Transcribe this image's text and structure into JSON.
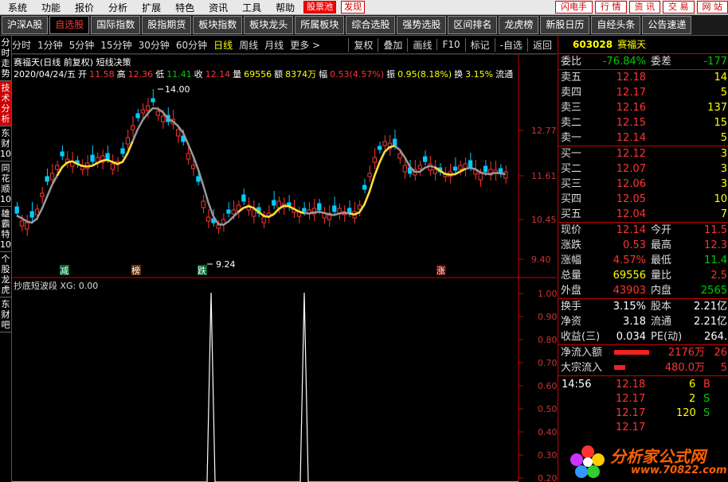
{
  "menu": {
    "items": [
      "系统",
      "功能",
      "报价",
      "分析",
      "扩展",
      "特色",
      "资讯",
      "工具",
      "帮助"
    ],
    "tag1": "股票池",
    "tag2": "发现",
    "right": [
      "闪电手",
      "行 情",
      "资 讯",
      "交 易",
      "网 站"
    ]
  },
  "tabs": [
    "沪深A股",
    "自选股",
    "国际指数",
    "股指期货",
    "板块指数",
    "板块龙头",
    "所属板块",
    "综合选股",
    "强势选股",
    "区间排名",
    "龙虎榜",
    "新股日历",
    "自经头条",
    "公告速递"
  ],
  "periods": [
    "分时",
    "1分钟",
    "5分钟",
    "15分钟",
    "30分钟",
    "60分钟",
    "日线",
    "周线",
    "月线",
    "更多 >"
  ],
  "toolbtns": [
    "复权",
    "叠加",
    "画线",
    "F10",
    "标记",
    "-自选",
    "返回"
  ],
  "lside": [
    "分时走势",
    "技术分析",
    "东财10",
    "同花顺10",
    "雄霸特10",
    "个股龙虎",
    "东财吧"
  ],
  "chart": {
    "title": "赛福天(日线 前复权) 短线决策",
    "date": "2020/04/24/五",
    "open_l": "开",
    "open": "11.58",
    "high_l": "高",
    "high": "12.36",
    "low_l": "低",
    "low": "11.41",
    "close_l": "收",
    "close": "12.14",
    "vol_l": "量",
    "vol": "69556",
    "amt_l": "额",
    "amt": "8374万",
    "chg_l": "幅",
    "chg": "0.53(4.57%)",
    "amp_l": "振",
    "amp": "0.95(8.18%)",
    "turn_l": "换",
    "turn": "3.15%",
    "flow": "流通",
    "max_label": "14.00",
    "min_label": "9.24",
    "axis": [
      "12.77",
      "11.61",
      "10.45",
      "9.40"
    ],
    "markers": [
      "减",
      "榜",
      "跌",
      "涨"
    ],
    "sub_title": "抄底短波段 XG: 0.00",
    "sub_axis": [
      "1.00",
      "0.90",
      "0.80",
      "0.70",
      "0.60",
      "0.50",
      "0.40",
      "0.30",
      "0.20"
    ]
  },
  "quote": {
    "code": "603028",
    "name": "赛福天",
    "wb_l": "委比",
    "wb": "-76.84%",
    "wc_l": "委差",
    "wc": "-177",
    "asks": [
      {
        "l": "卖五",
        "p": "12.18",
        "v": "14"
      },
      {
        "l": "卖四",
        "p": "12.17",
        "v": "5"
      },
      {
        "l": "卖三",
        "p": "12.16",
        "v": "137"
      },
      {
        "l": "卖二",
        "p": "12.15",
        "v": "15"
      },
      {
        "l": "卖一",
        "p": "12.14",
        "v": "5"
      }
    ],
    "bids": [
      {
        "l": "买一",
        "p": "12.12",
        "v": "3"
      },
      {
        "l": "买二",
        "p": "12.07",
        "v": "3"
      },
      {
        "l": "买三",
        "p": "12.06",
        "v": "3"
      },
      {
        "l": "买四",
        "p": "12.05",
        "v": "10"
      },
      {
        "l": "买五",
        "p": "12.04",
        "v": "7"
      }
    ],
    "stats": [
      {
        "l": "现价",
        "v": "12.14",
        "c": "red",
        "l2": "今开",
        "v2": "11.5",
        "c2": "red"
      },
      {
        "l": "涨跌",
        "v": "0.53",
        "c": "red",
        "l2": "最高",
        "v2": "12.3",
        "c2": "red"
      },
      {
        "l": "涨幅",
        "v": "4.57%",
        "c": "red",
        "l2": "最低",
        "v2": "11.4",
        "c2": "green"
      },
      {
        "l": "总量",
        "v": "69556",
        "c": "yel",
        "l2": "量比",
        "v2": "2.5",
        "c2": "red"
      },
      {
        "l": "外盘",
        "v": "43903",
        "c": "red",
        "l2": "内盘",
        "v2": "2565",
        "c2": "green"
      }
    ],
    "stats2": [
      {
        "l": "换手",
        "v": "3.15%",
        "l2": "股本",
        "v2": "2.21亿"
      },
      {
        "l": "净资",
        "v": "3.18",
        "l2": "流通",
        "v2": "2.21亿"
      },
      {
        "l": "收益(三)",
        "v": "0.034",
        "l2": "PE(动)",
        "v2": "264."
      }
    ],
    "flow": [
      {
        "l": "净流入额",
        "v": "2176万",
        "v2": "26"
      },
      {
        "l": "大宗流入",
        "v": "480.0万",
        "v2": "5"
      }
    ],
    "trades": [
      {
        "t": "14:56",
        "p": "12.18",
        "v": "6",
        "s": "B"
      },
      {
        "t": "",
        "p": "12.17",
        "v": "2",
        "s": "S"
      },
      {
        "t": "",
        "p": "12.17",
        "v": "120",
        "s": "S"
      },
      {
        "t": "",
        "p": "12.17",
        "v": "",
        "s": ""
      }
    ]
  },
  "watermark": {
    "cn": "分析家公式网",
    "url": "www.70822.com"
  }
}
